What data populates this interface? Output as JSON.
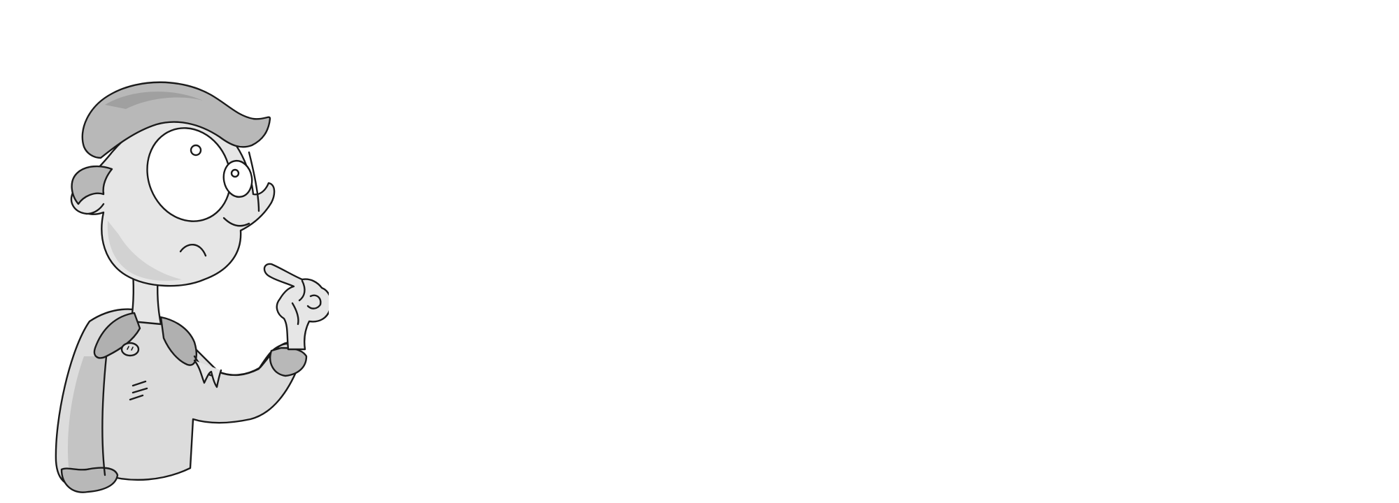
{
  "illustration": {
    "subject": "cartoon-boy-thinking",
    "colors": {
      "background": "#ffffff",
      "outline": "#1a1a1a",
      "skin": "#e6e6e6",
      "skin_shade": "#d2d2d2",
      "hair": "#b8b8b8",
      "hair_shade": "#a0a0a0",
      "jacket": "#dcdcdc",
      "jacket_shade": "#c4c4c4",
      "collar": "#b0b0b0",
      "eye_white": "#ffffff"
    }
  }
}
